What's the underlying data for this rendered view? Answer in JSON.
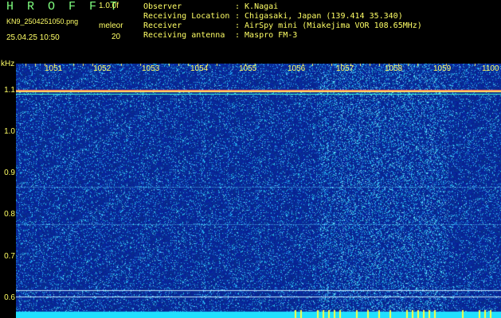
{
  "header": {
    "app_name": "H R O F F T",
    "version": "1.0.0f",
    "filename": "KN9_2504251050.png",
    "meleor_label": "meleor",
    "datetime": "25.04.25 10:50",
    "meleor_value": "20",
    "info": [
      {
        "key": "Observer",
        "value": ": K.Nagai"
      },
      {
        "key": "Receiving Location",
        "value": ": Chigasaki, Japan (139.414 35.340)"
      },
      {
        "key": "Receiver",
        "value": ": AirSpy mini (Miakejima VOR 108.65MHz)"
      },
      {
        "key": "Receiving antenna",
        "value": ": Maspro FM-3"
      }
    ]
  },
  "chart_data": {
    "type": "heatmap",
    "ylabel": "kHz",
    "x_ticks": [
      "1051",
      "1052",
      "1053",
      "1054",
      "1055",
      "1056",
      "1057",
      "1058",
      "1059",
      "1100"
    ],
    "y_ticks": [
      "1.1",
      "1.0",
      "0.9",
      "0.8",
      "0.7",
      "0.6"
    ],
    "ylim": [
      0.58,
      1.16
    ],
    "steady_carriers_khz": [
      1.1,
      1.095,
      0.87,
      0.78,
      0.62,
      0.605
    ],
    "colors": {
      "background": "#0a1a8c",
      "noise": "#3aa0ff",
      "carrier": "#ffe060",
      "baseline": "#20e0ff"
    }
  }
}
